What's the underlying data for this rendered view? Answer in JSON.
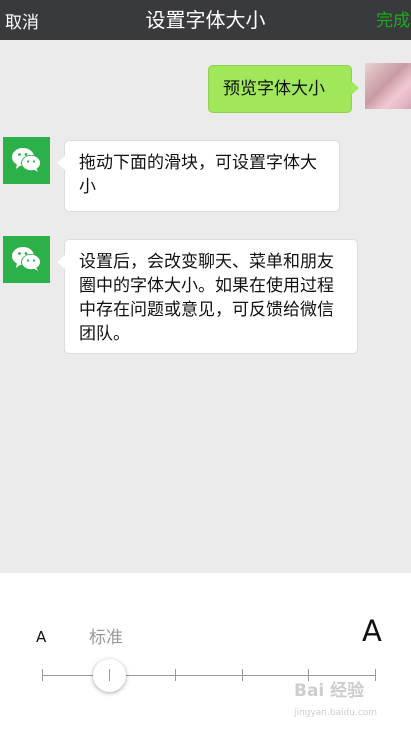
{
  "header": {
    "cancel_label": "取消",
    "title": "设置字体大小",
    "done_label": "完成"
  },
  "messages": [
    {
      "from": "self",
      "text": "预览字体大小"
    },
    {
      "from": "other",
      "text": "拖动下面的滑块，可设置字体大小"
    },
    {
      "from": "other",
      "text": "设置后，会改变聊天、菜单和朋友圈中的字体大小。如果在使用过程中存在问题或意见，可反馈给微信团队。"
    }
  ],
  "font_slider": {
    "small_label": "A",
    "current_label": "标准",
    "large_label": "A",
    "steps": 6,
    "selected_step": 2
  },
  "watermark": {
    "line1": "Bai 经验",
    "line2": "jingyan.baidu.com"
  },
  "colors": {
    "topbar": "#393a3e",
    "done": "#1aad19",
    "self_bubble": "#a0e75a",
    "wechat_icon_bg": "#2bb04a"
  }
}
